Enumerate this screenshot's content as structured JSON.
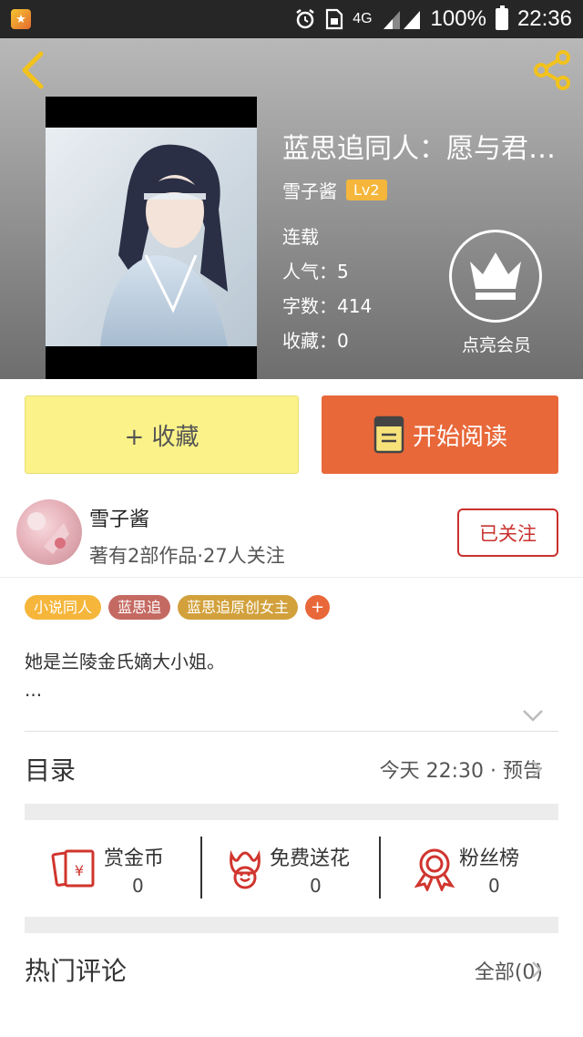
{
  "status_bar": {
    "network": "4G",
    "battery": "100%",
    "time": "22:36"
  },
  "book": {
    "title": "蓝思追同人：愿与君永...",
    "author": "雪子酱",
    "author_level": "Lv2",
    "status": "连载",
    "popularity": "人气：5",
    "word_count": "字数：414",
    "favorites": "收藏：0",
    "vip_label": "点亮会员"
  },
  "actions": {
    "favorite_label": "+ 收藏",
    "read_label": "开始阅读"
  },
  "author_info": {
    "name": "雪子酱",
    "stats": "著有2部作品·27人关注",
    "follow_label": "已关注"
  },
  "tags": [
    {
      "label": "小说同人",
      "color": "#f5b63b"
    },
    {
      "label": "蓝思追",
      "color": "#c56a62"
    },
    {
      "label": "蓝思追原创女主",
      "color": "#d2a13c"
    }
  ],
  "tag_add": "+",
  "description": {
    "text": "她是兰陵金氏嫡大小姐。",
    "more": "..."
  },
  "catalog": {
    "title": "目录",
    "info": "今天 22:30 · 预告"
  },
  "stats": [
    {
      "label": "赏金币",
      "value": "0",
      "icon": "red-envelope-icon"
    },
    {
      "label": "免费送花",
      "value": "0",
      "icon": "flower-icon"
    },
    {
      "label": "粉丝榜",
      "value": "0",
      "icon": "medal-icon"
    }
  ],
  "comments": {
    "title": "热门评论",
    "all_label": "全部(0)"
  },
  "colors": {
    "accent_orange": "#e8683a",
    "fav_yellow": "#fbf389",
    "follow_red": "#c9312e",
    "level_badge": "#f5b63b"
  }
}
